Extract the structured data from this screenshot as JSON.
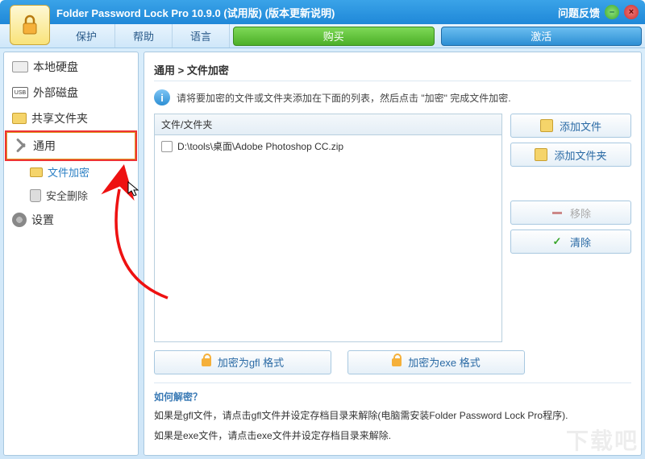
{
  "title": "Folder Password Lock Pro 10.9.0 (试用版) (版本更新说明)",
  "feedback": "问题反馈",
  "menu": {
    "protect": "保护",
    "help": "帮助",
    "lang": "语言",
    "buy": "购买",
    "activate": "激活"
  },
  "sidebar": {
    "items": [
      {
        "label": "本地硬盘"
      },
      {
        "label": "外部磁盘",
        "usb": "USB"
      },
      {
        "label": "共享文件夹"
      },
      {
        "label": "通用"
      },
      {
        "label": "设置"
      }
    ],
    "sub": [
      {
        "label": "文件加密"
      },
      {
        "label": "安全删除"
      }
    ]
  },
  "breadcrumb": "通用 > 文件加密",
  "hint": "请将要加密的文件或文件夹添加在下面的列表，然后点击 \"加密\" 完成文件加密.",
  "list": {
    "header": "文件/文件夹",
    "rows": [
      {
        "path": "D:\\tools\\桌面\\Adobe Photoshop CC.zip"
      }
    ]
  },
  "btns": {
    "addFile": "添加文件",
    "addFolder": "添加文件夹",
    "remove": "移除",
    "clear": "清除",
    "encGfl": "加密为gfl 格式",
    "encExe": "加密为exe 格式"
  },
  "help": {
    "title": "如何解密？",
    "line1": "如果是gfl文件，请点击gfl文件并设定存档目录来解除(电脑需安装Folder Password Lock Pro程序).",
    "line2": "如果是exe文件，请点击exe文件并设定存档目录来解除."
  },
  "watermark": "下载吧"
}
